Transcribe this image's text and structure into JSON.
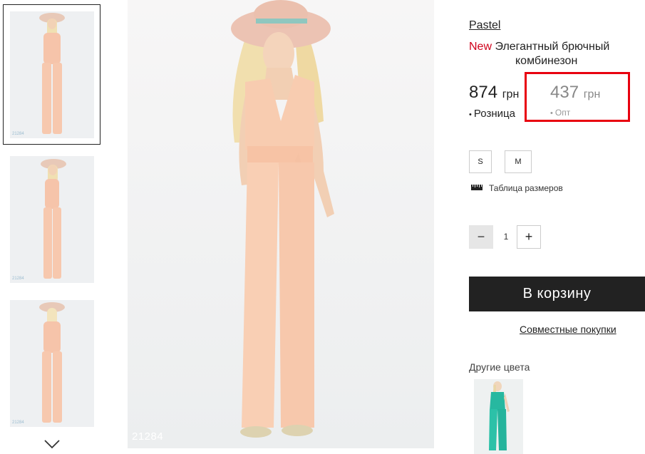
{
  "gallery": {
    "thumb_codes": [
      "21284",
      "21284",
      "21284"
    ],
    "main_code": "21284",
    "next_icon": "chevron-down-icon"
  },
  "product": {
    "brand": "Pastel",
    "badge": "New",
    "title_line1": "Элегантный брючный",
    "title_line2": "комбинезон",
    "retail_price": "874",
    "retail_currency": "грн",
    "retail_label": "Розница",
    "wholesale_price": "437",
    "wholesale_currency": "грн",
    "wholesale_label": "Опт",
    "highlight_color": "#e8000f"
  },
  "sizes": [
    "S",
    "M"
  ],
  "size_table_label": "Таблица размеров",
  "quantity": {
    "minus": "−",
    "value": "1",
    "plus": "+"
  },
  "cart_button": "В корзину",
  "joint_purchase_link": "Совместные покупки",
  "other_colors_label": "Другие цвета"
}
